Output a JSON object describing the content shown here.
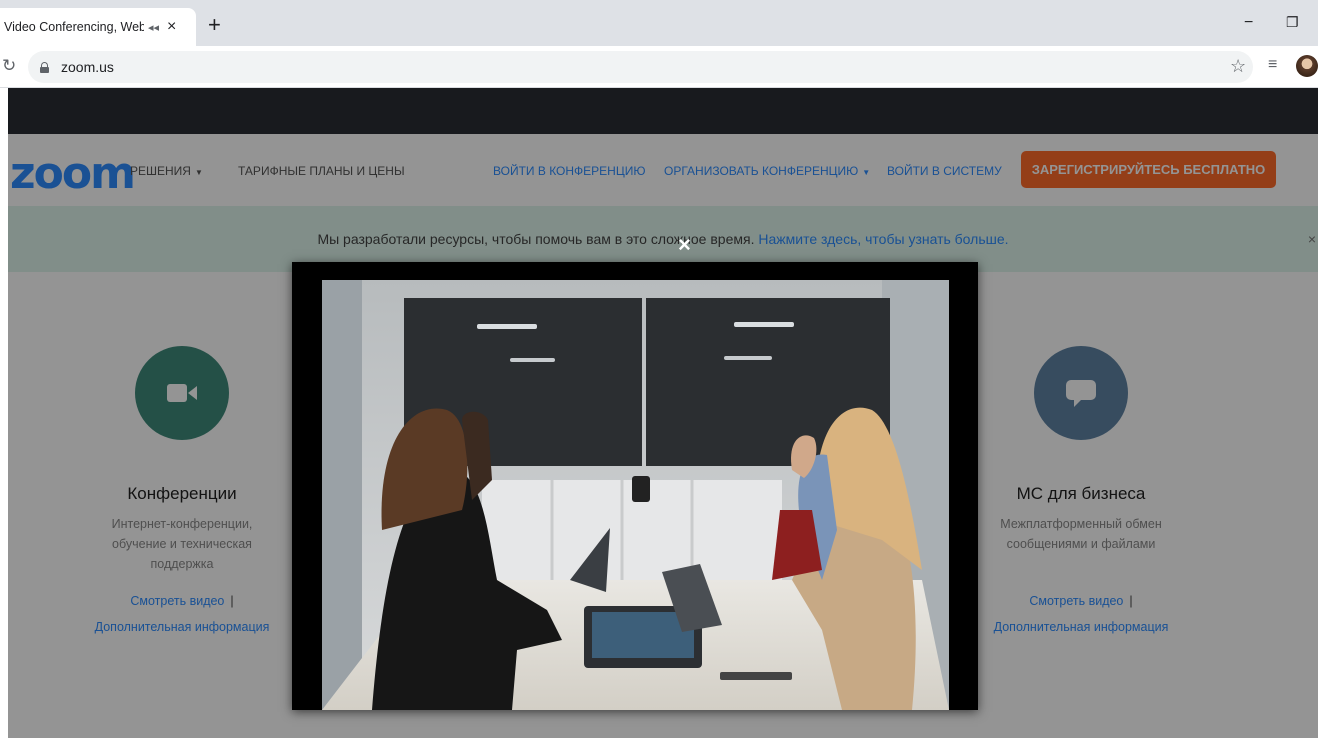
{
  "browser": {
    "tab_title": "Video Conferencing, Web Co",
    "tab_audio_icon": "speaker-icon",
    "tab_close": "×",
    "new_tab": "+",
    "url": "zoom.us",
    "minimize": "−",
    "restore": "❐"
  },
  "nav": {
    "logo": "zoom",
    "solutions": "РЕШЕНИЯ",
    "plans": "ТАРИФНЫЕ ПЛАНЫ И ЦЕНЫ",
    "join": "ВОЙТИ В КОНФЕРЕНЦИЮ",
    "host": "ОРГАНИЗОВАТЬ КОНФЕРЕНЦИЮ",
    "signin": "ВОЙТИ В СИСТЕМУ",
    "signup": "ЗАРЕГИСТРИРУЙТЕСЬ БЕСПЛАТНО"
  },
  "banner": {
    "text": "Мы разработали ресурсы, чтобы помочь вам в это сложное время.",
    "link": "Нажмите здесь, чтобы узнать больше.",
    "close": "×"
  },
  "features": [
    {
      "title": "Конференции",
      "desc": [
        "Интернет-конференции,",
        "обучение и техническая",
        "поддержка"
      ],
      "watch": "Смотреть видео",
      "more": "Дополнительная информация",
      "color": "#3f8a7b",
      "icon": "video-camera-icon"
    },
    {
      "title": "МС для бизнеса",
      "desc": [
        "Межплатформенный обмен",
        "сообщениями и файлами"
      ],
      "watch": "Смотреть видео",
      "more": "Дополнительная информация",
      "color": "#5f84a4",
      "icon": "chat-bubble-icon"
    }
  ],
  "separator": "|",
  "modal": {
    "close": "×",
    "video": "meeting-room-video"
  },
  "colors": {
    "brand_blue": "#2d8cff",
    "signup_orange": "#ff6b2a",
    "banner_green": "#def5ec"
  }
}
